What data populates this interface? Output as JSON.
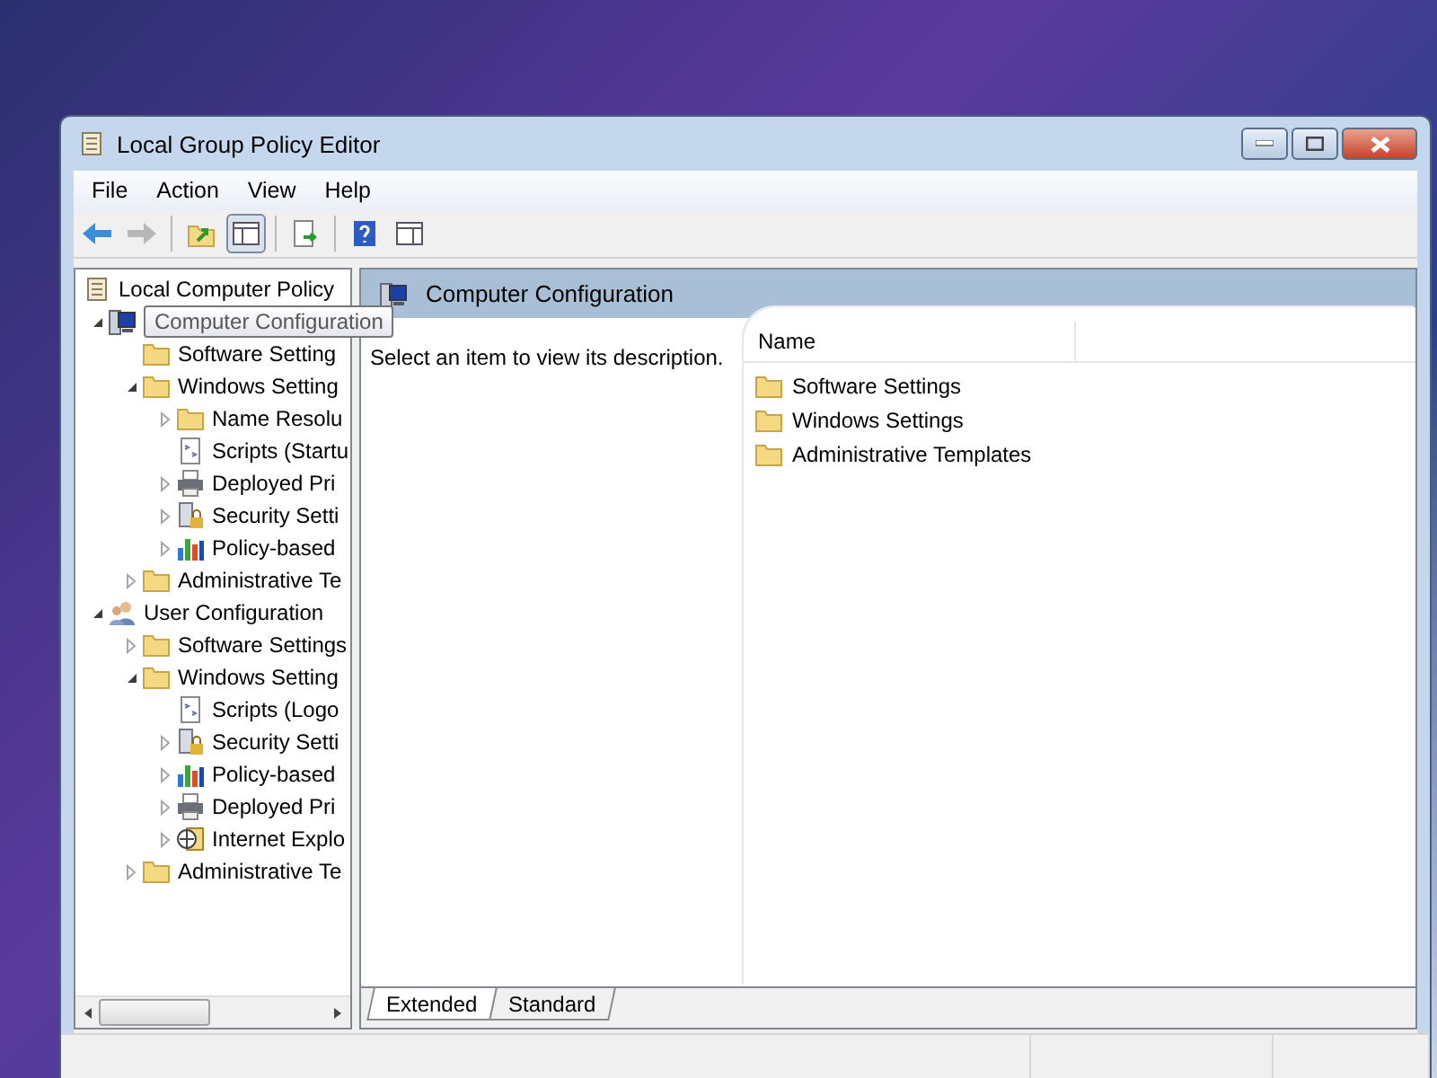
{
  "window": {
    "title": "Local Group Policy Editor"
  },
  "menu": [
    "File",
    "Action",
    "View",
    "Help"
  ],
  "toolbar": [
    {
      "kind": "back",
      "disabled": false
    },
    {
      "kind": "forward",
      "disabled": true
    },
    {
      "kind": "separator"
    },
    {
      "kind": "up",
      "disabled": false
    },
    {
      "kind": "tree-toggle",
      "selected": true
    },
    {
      "kind": "separator"
    },
    {
      "kind": "export",
      "disabled": false
    },
    {
      "kind": "separator"
    },
    {
      "kind": "help",
      "disabled": false
    },
    {
      "kind": "panel",
      "disabled": false
    }
  ],
  "tree": {
    "label": "Local Computer Policy",
    "kind": "policy",
    "children": [
      {
        "label": "Computer Configuration",
        "kind": "computer",
        "expanded": true,
        "hovered": true,
        "children": [
          {
            "label": "Software Setting",
            "kind": "folder"
          },
          {
            "label": "Windows Setting",
            "kind": "folder",
            "expanded": true,
            "children": [
              {
                "label": "Name Resolu",
                "kind": "folder",
                "expanded": false
              },
              {
                "label": "Scripts (Startu",
                "kind": "script"
              },
              {
                "label": "Deployed Pri",
                "kind": "printer",
                "expanded": false
              },
              {
                "label": "Security Setti",
                "kind": "security",
                "expanded": false
              },
              {
                "label": "Policy-based",
                "kind": "chart",
                "expanded": false
              }
            ]
          },
          {
            "label": "Administrative Te",
            "kind": "folder",
            "expanded": false
          }
        ]
      },
      {
        "label": "User Configuration",
        "kind": "user",
        "expanded": true,
        "hovered": false,
        "children": [
          {
            "label": "Software Settings",
            "kind": "folder",
            "expanded": false
          },
          {
            "label": "Windows Setting",
            "kind": "folder",
            "expanded": true,
            "children": [
              {
                "label": "Scripts (Logo",
                "kind": "script"
              },
              {
                "label": "Security Setti",
                "kind": "security",
                "expanded": false
              },
              {
                "label": "Policy-based",
                "kind": "chart",
                "expanded": false
              },
              {
                "label": "Deployed Pri",
                "kind": "printer",
                "expanded": false
              },
              {
                "label": "Internet Explo",
                "kind": "ie",
                "expanded": false
              }
            ]
          },
          {
            "label": "Administrative Te",
            "kind": "folder",
            "expanded": false
          }
        ]
      }
    ]
  },
  "details": {
    "header": "Computer Configuration",
    "description": "Select an item to view its description.",
    "columns": [
      "Name"
    ],
    "items": [
      "Software Settings",
      "Windows Settings",
      "Administrative Templates"
    ]
  },
  "view_tabs": [
    {
      "label": "Extended",
      "selected": true
    },
    {
      "label": "Standard",
      "selected": false
    }
  ]
}
